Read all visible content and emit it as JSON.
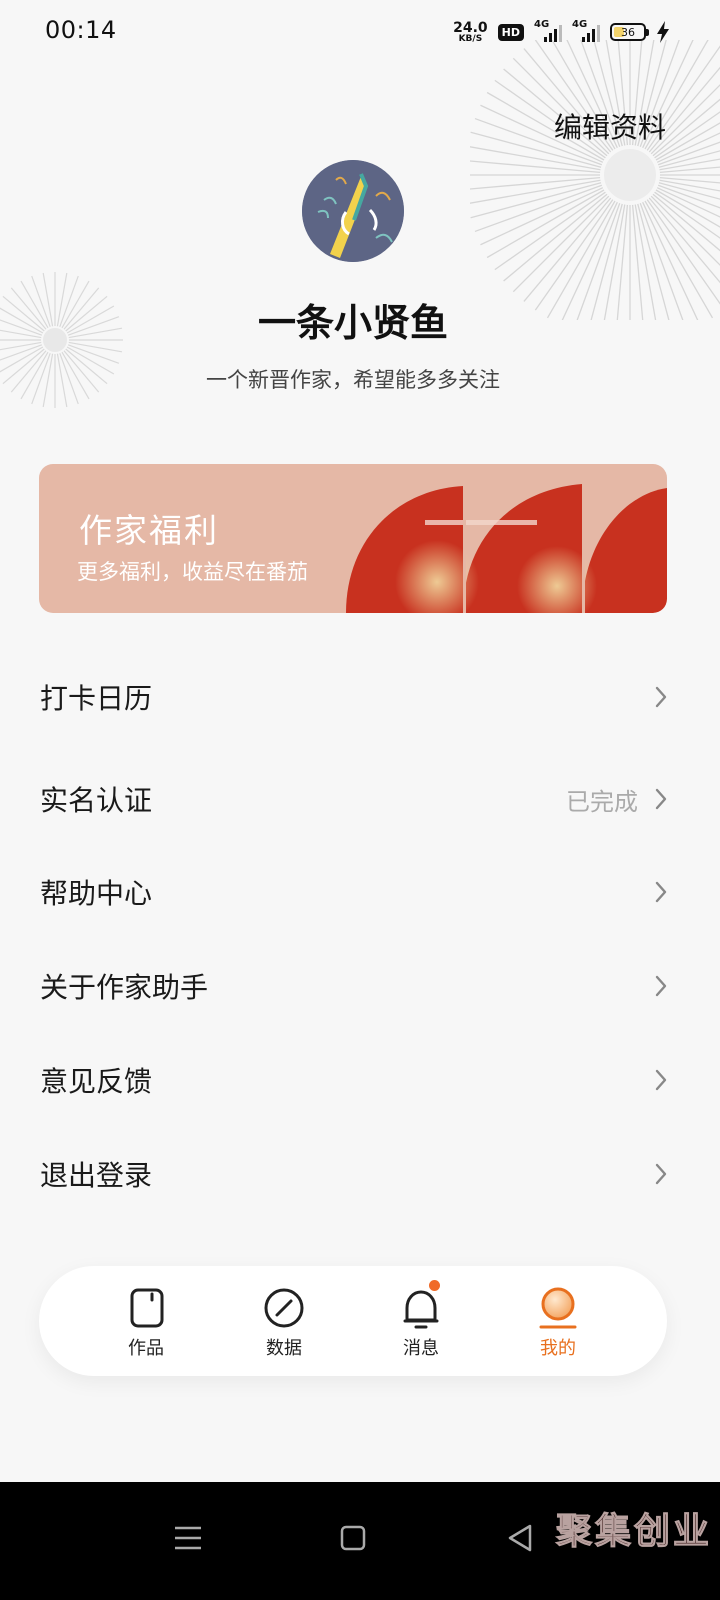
{
  "status_bar": {
    "time": "00:14",
    "net_speed_value": "24.0",
    "net_speed_unit": "KB/S",
    "hd_label": "HD",
    "signal1_label": "4G",
    "signal2_label": "4G",
    "battery_level": "36",
    "battery_fill_percent": 36
  },
  "header": {
    "edit_profile_label": "编辑资料",
    "username": "一条小贤鱼",
    "bio": "一个新晋作家，希望能多多关注"
  },
  "banner": {
    "title": "作家福利",
    "subtitle": "更多福利，收益尽在番茄"
  },
  "menu": {
    "items": [
      {
        "label": "打卡日历",
        "status": ""
      },
      {
        "label": "实名认证",
        "status": "已完成"
      },
      {
        "label": "帮助中心",
        "status": ""
      },
      {
        "label": "关于作家助手",
        "status": ""
      },
      {
        "label": "意见反馈",
        "status": ""
      },
      {
        "label": "退出登录",
        "status": ""
      }
    ]
  },
  "bottom_nav": {
    "tabs": [
      {
        "label": "作品",
        "icon": "works-icon",
        "active": false
      },
      {
        "label": "数据",
        "icon": "data-icon",
        "active": false
      },
      {
        "label": "消息",
        "icon": "bell-icon",
        "active": false,
        "has_notification": true
      },
      {
        "label": "我的",
        "icon": "profile-icon",
        "active": true
      }
    ]
  },
  "system_nav": {
    "buttons": [
      "menu-icon",
      "home-icon",
      "back-icon"
    ],
    "watermark": "聚集创业"
  },
  "colors": {
    "background": "#f7f7f7",
    "accent": "#e8701f",
    "notification_dot": "#f06a28",
    "banner_bg": "#e5b8a6",
    "banner_red": "#c8311f"
  }
}
